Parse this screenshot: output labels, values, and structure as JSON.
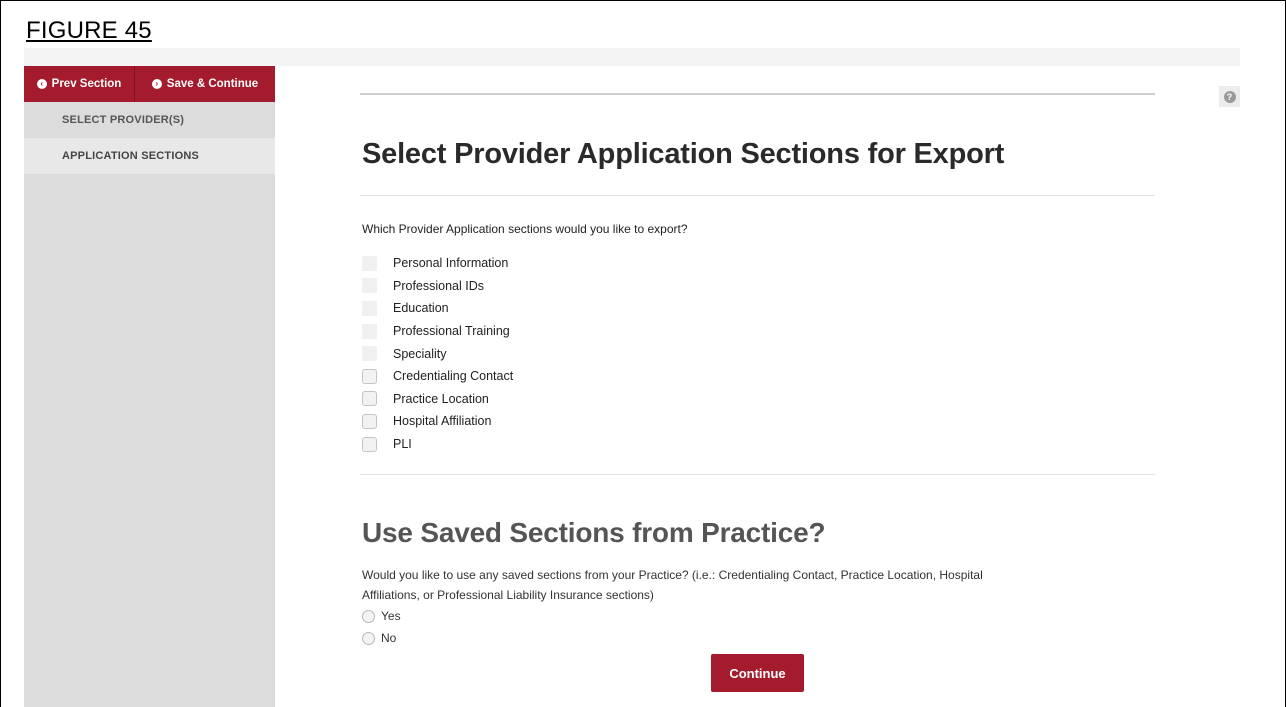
{
  "figure": {
    "label": "FIGURE 45"
  },
  "sidebar": {
    "prev_button": "Prev Section",
    "save_button": "Save & Continue",
    "items": [
      {
        "label": "SELECT PROVIDER(S)",
        "active": false
      },
      {
        "label": "APPLICATION SECTIONS",
        "active": true
      }
    ]
  },
  "help": {
    "icon": "question-circle-icon",
    "glyph": "?"
  },
  "main": {
    "title": "Select Provider Application Sections for Export",
    "question": "Which Provider Application sections would you like to export?",
    "sections": [
      {
        "label": "Personal Information",
        "checked": false,
        "style": "flat"
      },
      {
        "label": "Professional IDs",
        "checked": false,
        "style": "flat"
      },
      {
        "label": "Education",
        "checked": false,
        "style": "flat"
      },
      {
        "label": "Professional Training",
        "checked": false,
        "style": "flat"
      },
      {
        "label": "Speciality",
        "checked": false,
        "style": "flat"
      },
      {
        "label": "Credentialing Contact",
        "checked": false,
        "style": "box"
      },
      {
        "label": "Practice Location",
        "checked": false,
        "style": "box"
      },
      {
        "label": "Hospital Affiliation",
        "checked": false,
        "style": "box"
      },
      {
        "label": "PLI",
        "checked": false,
        "style": "box"
      }
    ],
    "saved_title": "Use Saved Sections from Practice?",
    "saved_question_line1": "Would you like to use any saved sections from your Practice? (i.e.: Credentialing Contact, Practice Location, Hospital",
    "saved_question_line2": "Affiliations, or Professional Liability Insurance sections)",
    "options": [
      {
        "label": "Yes",
        "selected": false
      },
      {
        "label": "No",
        "selected": false
      }
    ],
    "continue_label": "Continue"
  },
  "colors": {
    "brand": "#a31b2d",
    "sidebar_bg": "#dcdcdc"
  }
}
